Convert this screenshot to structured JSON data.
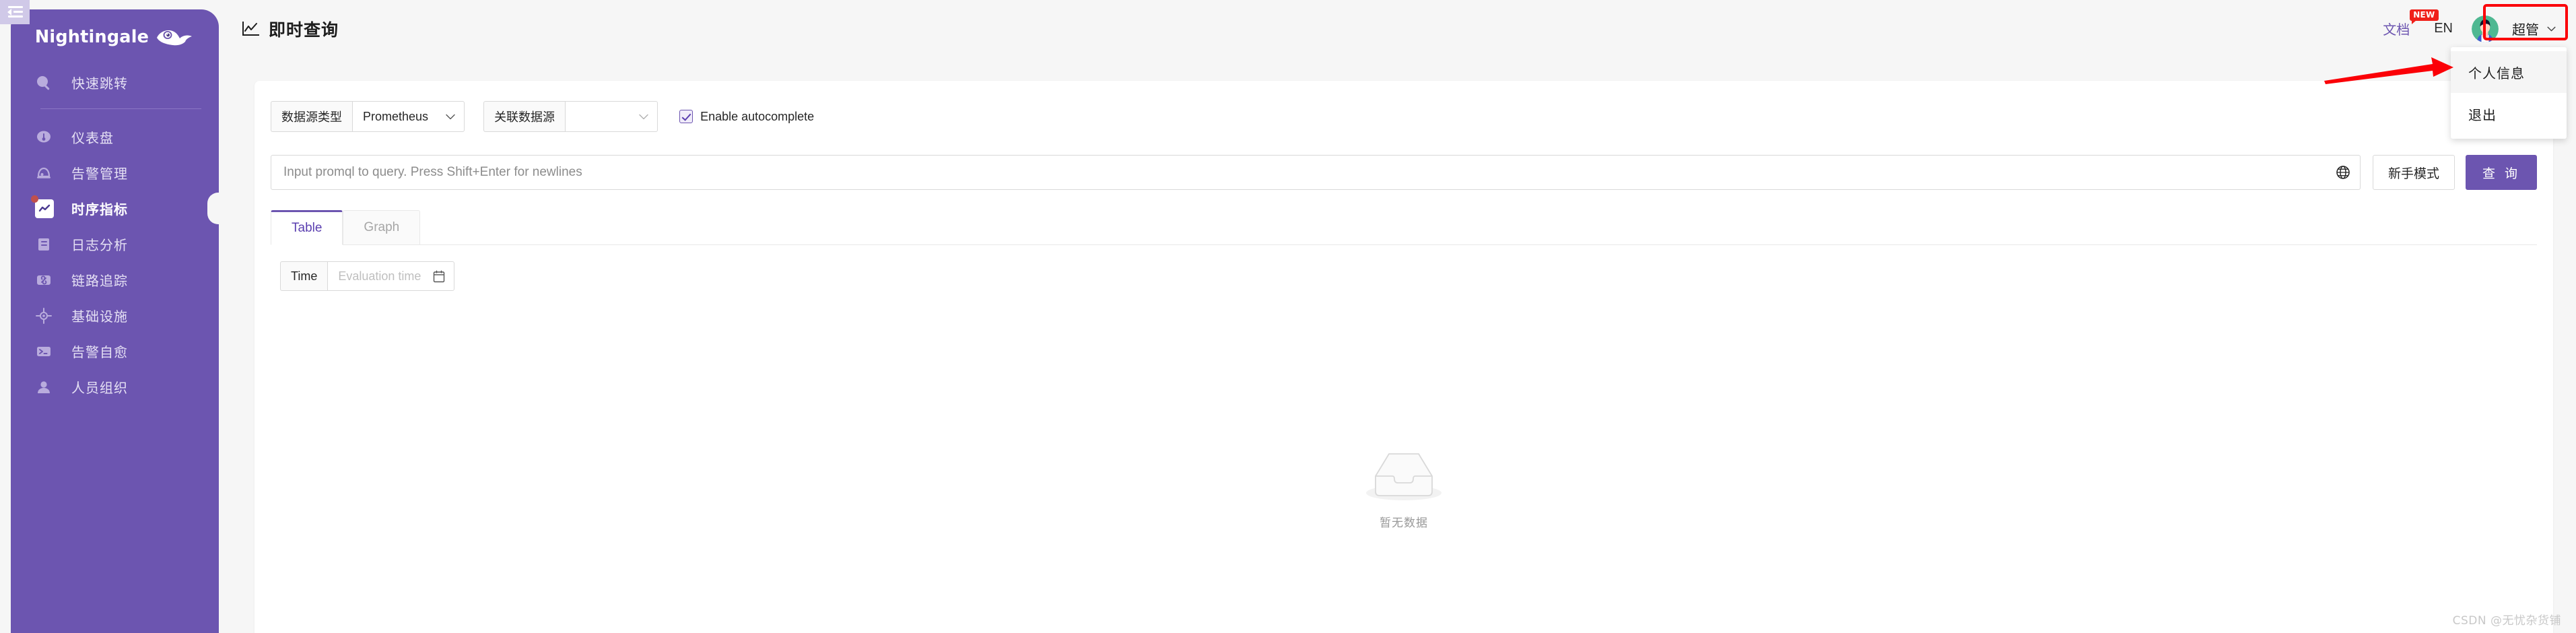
{
  "sidebar": {
    "brand": "Nightingale",
    "collapse_icon": "menu-collapse-icon",
    "items": [
      {
        "label": "快速跳转",
        "icon": "search-icon",
        "active": false
      },
      {
        "label": "仪表盘",
        "icon": "dashboard-gauge-icon",
        "active": false
      },
      {
        "label": "告警管理",
        "icon": "alarm-bell-icon",
        "active": false
      },
      {
        "label": "时序指标",
        "icon": "metrics-chart-icon",
        "active": true,
        "badge": true
      },
      {
        "label": "日志分析",
        "icon": "log-document-icon",
        "active": false
      },
      {
        "label": "链路追踪",
        "icon": "link-trace-icon",
        "active": false
      },
      {
        "label": "基础设施",
        "icon": "infrastructure-target-icon",
        "active": false
      },
      {
        "label": "告警自愈",
        "icon": "terminal-console-icon",
        "active": false
      },
      {
        "label": "人员组织",
        "icon": "user-group-icon",
        "active": false
      }
    ]
  },
  "header": {
    "title": "即时查询",
    "title_icon": "line-chart-icon",
    "doc_link": "文档",
    "doc_badge": "NEW",
    "lang": "EN",
    "avatar_icon": "user-avatar",
    "user_name": "超管",
    "chevron_icon": "chevron-down-icon",
    "menu": [
      {
        "label": "个人信息",
        "hovered": true
      },
      {
        "label": "退出",
        "hovered": false
      }
    ]
  },
  "toolbar": {
    "datasource_type_label": "数据源类型",
    "datasource_type_value": "Prometheus",
    "related_datasource_label": "关联数据源",
    "related_datasource_value": "",
    "autocomplete_label": "Enable autocomplete",
    "autocomplete_checked": true
  },
  "query": {
    "placeholder": "Input promql to query. Press Shift+Enter for newlines",
    "value": "",
    "globe_icon": "globe-icon",
    "novice_mode_label": "新手模式",
    "search_label": "查 询"
  },
  "tabs": [
    {
      "label": "Table",
      "active": true
    },
    {
      "label": "Graph",
      "active": false
    }
  ],
  "time_picker": {
    "label": "Time",
    "placeholder": "Evaluation time",
    "value": "",
    "calendar_icon": "calendar-icon"
  },
  "empty_state": {
    "text": "暂无数据",
    "icon": "empty-box-icon"
  },
  "watermark": "CSDN @无忧杂货铺",
  "colors": {
    "brand_purple": "#6c55b0",
    "accent_purple": "#5b3fb0",
    "annotation_red": "#fb0007",
    "badge_red": "#f0201a",
    "page_bg": "#f6f6f6",
    "card_bg": "#ffffff",
    "border_gray": "#d9d9d9"
  }
}
